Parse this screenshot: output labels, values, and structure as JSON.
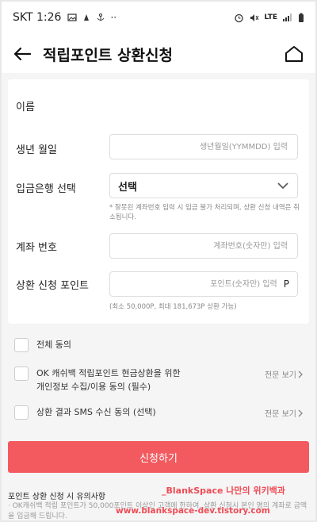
{
  "status_bar": {
    "carrier": "SKT",
    "time": "1:26",
    "network": "LTE"
  },
  "header": {
    "title": "적립포인트 상환신청"
  },
  "form": {
    "name_label": "이름",
    "birth_label": "생년 월일",
    "birth_placeholder": "생년월일(YYMMDD) 입력",
    "bank_label": "입금은행 선택",
    "bank_selected": "선택",
    "bank_note": "* 잘못된 계좌번호 입력 시 입금 불가 처리되며, 상환 신청 내역은 취소됩니다.",
    "account_label": "계좌 번호",
    "account_placeholder": "계좌번호(숫자만) 입력",
    "points_label": "상환 신청 포인트",
    "points_placeholder": "포인트(숫자만) 입력",
    "points_unit": "P",
    "points_note": "(최소 50,000P, 최대 181,673P 상환 가능)"
  },
  "agreements": {
    "all_label": "전체 동의",
    "privacy_label_line1": "OK 캐쉬백 적립포인트 현금상환을 위한",
    "privacy_label_line2": "개인정보 수집/이용 동의 (필수)",
    "privacy_more": "전문 보기",
    "sms_label": "상환 결과 SMS 수신 동의 (선택)",
    "sms_more": "전문 보기"
  },
  "apply_button": "신청하기",
  "notice": {
    "title": "포인트 상환 신청 시 유의사항",
    "line1": "· OK캐쉬백 적립 포인트가 50,000포인트 이상인 고객에 한하여, 상환 신청시 본인 명의 계좌로 금액을 입금해 드립니다."
  },
  "watermark": {
    "line1": "_BlankSpace 나만의 위키백과",
    "line2": "www.blankspace-dev.tistory.com"
  },
  "colors": {
    "accent": "#f25a5f",
    "watermark": "#ef4b55"
  }
}
